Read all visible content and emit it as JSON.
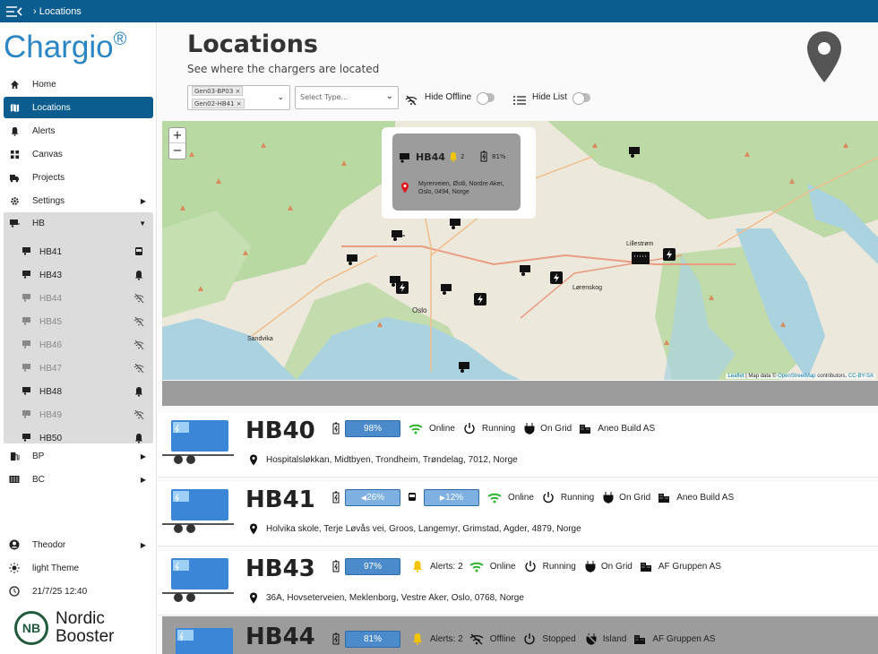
{
  "topbar": {
    "breadcrumb": "› Locations"
  },
  "sidebar": {
    "logo": "Chargio",
    "logo_mark": "®",
    "items": [
      {
        "label": "Home",
        "icon": "home-icon"
      },
      {
        "label": "Locations",
        "icon": "map-icon",
        "active": true
      },
      {
        "label": "Alerts",
        "icon": "bell-icon"
      },
      {
        "label": "Canvas",
        "icon": "grid-icon"
      },
      {
        "label": "Projects",
        "icon": "truck-icon"
      },
      {
        "label": "Settings",
        "icon": "gear-icon"
      }
    ],
    "group": {
      "label": "HB",
      "icon": "trailer-icon"
    },
    "sub_items": [
      {
        "label": "HB41",
        "status": "vehicle",
        "offline": false
      },
      {
        "label": "HB43",
        "status": "alert",
        "offline": false
      },
      {
        "label": "HB44",
        "status": "wifi-off",
        "offline": true
      },
      {
        "label": "HB45",
        "status": "wifi-off",
        "offline": true
      },
      {
        "label": "HB46",
        "status": "wifi-off",
        "offline": true
      },
      {
        "label": "HB47",
        "status": "wifi-off",
        "offline": true
      },
      {
        "label": "HB48",
        "status": "alert",
        "offline": false
      },
      {
        "label": "HB49",
        "status": "wifi-off",
        "offline": true
      },
      {
        "label": "HB50",
        "status": "alert",
        "offline": false
      }
    ],
    "bp": "BP",
    "bc": "BC",
    "user": "Theodor",
    "theme": "light Theme",
    "time": "21/7/25 12:40",
    "nordic1": "Nordic",
    "nordic2": "Booster",
    "nordic_mark": "NB"
  },
  "main": {
    "title": "Locations",
    "subtitle": "See where the chargers are located",
    "chips": [
      "Gen03-BP03",
      "Gen02-HB41"
    ],
    "select_placeholder": "Select Type...",
    "hide_offline": "Hide Offline",
    "hide_list": "Hide List"
  },
  "map": {
    "zoom_in": "+",
    "zoom_out": "−",
    "popup": {
      "name": "HB44",
      "alerts": "2",
      "battery": "81%",
      "address": "Myrerveien, Østli, Nordre Aker, Oslo, 0494, Norge"
    },
    "labels": {
      "oslo": "Oslo",
      "lillestrom": "Lillestrøm",
      "lorenskog": "Lørenskog",
      "sandvika": "Sandvika"
    },
    "attribution_leaflet": "Leaflet",
    "attribution_text": "| Map data ©",
    "attribution_osm": "OpenStreetMap",
    "attribution_contrib": "contributors,",
    "attribution_license": "CC-BY-SA"
  },
  "chargers": [
    {
      "name": "HB40",
      "battery": "98%",
      "status": "Online",
      "run": "Running",
      "grid": "On Grid",
      "company": "Aneo Build AS",
      "address": "Hospitalsløkkan, Midtbyen, Trondheim, Trøndelag, 7012, Norge"
    },
    {
      "name": "HB41",
      "battery": "26%",
      "battery2": "12%",
      "status": "Online",
      "run": "Running",
      "grid": "On Grid",
      "company": "Aneo Build AS",
      "address": "Holvika skole, Terje Løvås vei, Groos, Langemyr, Grimstad, Agder, 4879, Norge"
    },
    {
      "name": "HB43",
      "battery": "97%",
      "alerts": "Alerts: 2",
      "status": "Online",
      "run": "Running",
      "grid": "On Grid",
      "company": "AF Gruppen AS",
      "address": "36A, Hovseterveien, Meklenborg, Vestre Aker, Oslo, 0768, Norge"
    },
    {
      "name": "HB44",
      "battery": "81%",
      "alerts": "Alerts: 2",
      "status": "Offline",
      "run": "Stopped",
      "grid": "Island",
      "company": "AF Gruppen AS"
    }
  ],
  "colors": {
    "brand": "#0b5d8f",
    "logo": "#2b86c5",
    "battery": "#4b8bcb",
    "online": "#2bb52b",
    "alert": "#f5c400"
  }
}
